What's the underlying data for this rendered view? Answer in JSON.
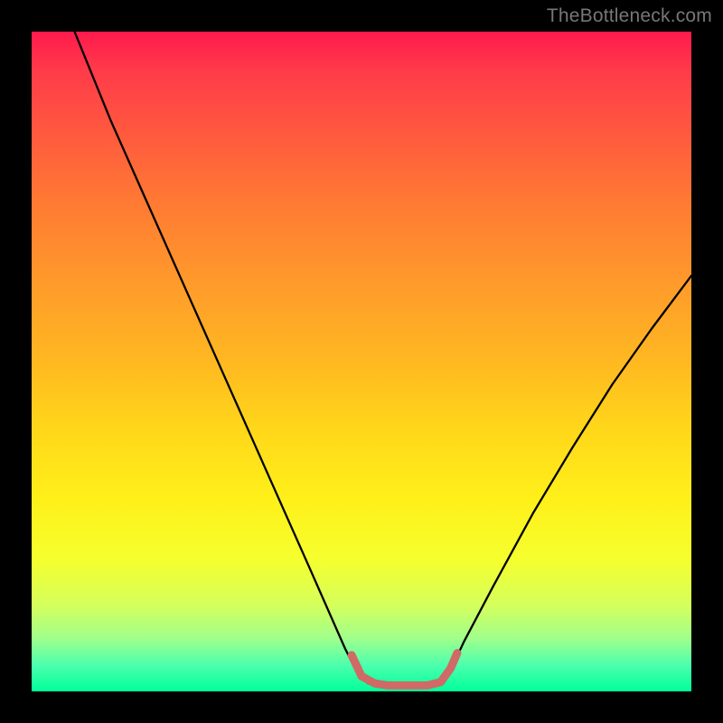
{
  "watermark": "TheBottleneck.com",
  "chart_data": {
    "type": "line",
    "title": "",
    "xlabel": "",
    "ylabel": "",
    "xlim": [
      0,
      100
    ],
    "ylim": [
      0,
      100
    ],
    "note": "No visible axis ticks or labels; values are inferred from pixel geometry only.",
    "series": [
      {
        "name": "black-curve",
        "stroke": "#000000",
        "points": [
          {
            "x": 6.5,
            "y": 100
          },
          {
            "x": 12,
            "y": 86.5
          },
          {
            "x": 18,
            "y": 73
          },
          {
            "x": 24,
            "y": 59.5
          },
          {
            "x": 30,
            "y": 46
          },
          {
            "x": 36,
            "y": 32.5
          },
          {
            "x": 42,
            "y": 19
          },
          {
            "x": 47.5,
            "y": 6.5
          },
          {
            "x": 49.5,
            "y": 2.5
          },
          {
            "x": 51,
            "y": 1.2
          },
          {
            "x": 54,
            "y": 0.9
          },
          {
            "x": 57,
            "y": 0.9
          },
          {
            "x": 60,
            "y": 0.9
          },
          {
            "x": 62,
            "y": 1.4
          },
          {
            "x": 63.5,
            "y": 3.2
          },
          {
            "x": 65.5,
            "y": 7.5
          },
          {
            "x": 70,
            "y": 16
          },
          {
            "x": 76,
            "y": 27
          },
          {
            "x": 82,
            "y": 37
          },
          {
            "x": 88,
            "y": 46.5
          },
          {
            "x": 94,
            "y": 55
          },
          {
            "x": 100,
            "y": 63
          }
        ]
      },
      {
        "name": "trough-highlight",
        "stroke": "#d06a66",
        "points": [
          {
            "x": 48.5,
            "y": 5.5
          },
          {
            "x": 50,
            "y": 2.3
          },
          {
            "x": 52,
            "y": 1.2
          },
          {
            "x": 54,
            "y": 0.9
          },
          {
            "x": 57,
            "y": 0.9
          },
          {
            "x": 60,
            "y": 0.9
          },
          {
            "x": 62,
            "y": 1.4
          },
          {
            "x": 63.5,
            "y": 3.5
          },
          {
            "x": 64.5,
            "y": 5.8
          }
        ]
      }
    ]
  }
}
